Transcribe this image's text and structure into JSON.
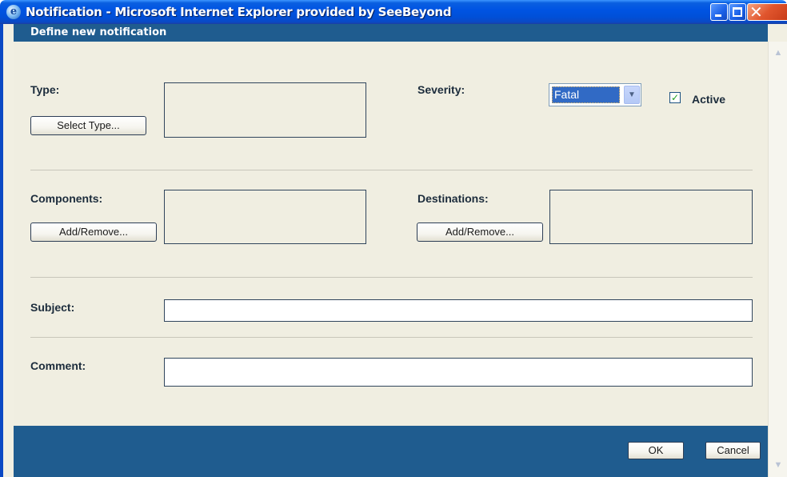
{
  "window": {
    "title": "Notification - Microsoft Internet Explorer provided by SeeBeyond",
    "icon": "ie-logo-icon"
  },
  "form": {
    "header": "Define new notification",
    "type_label": "Type:",
    "select_type_button": "Select Type...",
    "severity_label": "Severity:",
    "severity_value": "Fatal",
    "active_label": "Active",
    "active_checked": true,
    "components_label": "Components:",
    "components_button": "Add/Remove...",
    "destinations_label": "Destinations:",
    "destinations_button": "Add/Remove...",
    "subject_label": "Subject:",
    "subject_value": "",
    "comment_label": "Comment:",
    "comment_value": ""
  },
  "footer": {
    "ok_label": "OK",
    "cancel_label": "Cancel"
  },
  "glyphs": {
    "checkmark": "✓",
    "dropdown": "▼",
    "close": "✕",
    "scroll_up": "▲",
    "scroll_down": "▼",
    "ie_logo": "e"
  },
  "colors": {
    "header_bg": "#1f5c8f",
    "form_bg": "#f0eee1",
    "titlebar": "#0054e3",
    "selected": "#316ac5"
  }
}
